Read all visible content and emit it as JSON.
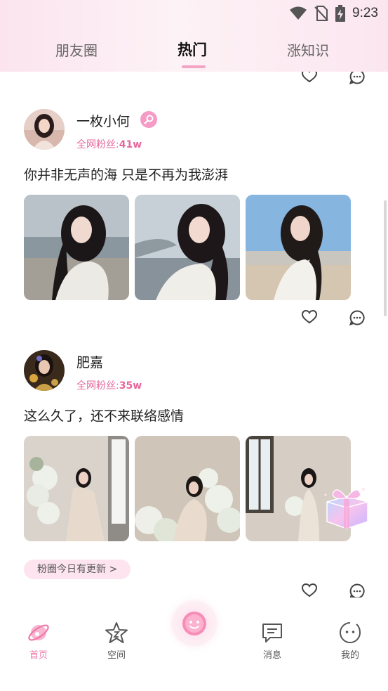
{
  "status_bar": {
    "time": "9:23",
    "icons": [
      "wifi-icon",
      "no-sim-icon",
      "battery-charging-icon"
    ]
  },
  "tabs": [
    {
      "label": "朋友圈",
      "active": false
    },
    {
      "label": "热门",
      "active": true
    },
    {
      "label": "涨知识",
      "active": false
    }
  ],
  "colors": {
    "accent": "#ef79a8",
    "fans_text": "#e5679b",
    "header_bg": "#fbe4ee",
    "pill_bg": "#fde4ee"
  },
  "posts": [
    {
      "username": "一枚小何",
      "verified_badge": "search-badge-icon",
      "fans_label": "全网粉丝:",
      "fans_count": "41w",
      "text": "你并非无声的海 只是不再为我澎湃",
      "photos": [
        "beach-portrait-1",
        "beach-portrait-2",
        "beach-portrait-3"
      ]
    },
    {
      "username": "肥嘉",
      "fans_label": "全网粉丝:",
      "fans_count": "35w",
      "text": "这么久了，还不来联络感情",
      "photos": [
        "flower-room-portrait-1",
        "flower-room-portrait-2",
        "flower-room-portrait-3"
      ]
    }
  ],
  "update_pill": "粉圈今日有更新 >",
  "bottom_nav": [
    {
      "label": "首页",
      "icon": "planet-icon",
      "active": true
    },
    {
      "label": "空间",
      "icon": "star-icon",
      "active": false
    },
    {
      "label": "",
      "icon": "smiley-face-icon",
      "active": false
    },
    {
      "label": "消息",
      "icon": "message-icon",
      "active": false
    },
    {
      "label": "我的",
      "icon": "profile-face-icon",
      "active": false
    }
  ]
}
